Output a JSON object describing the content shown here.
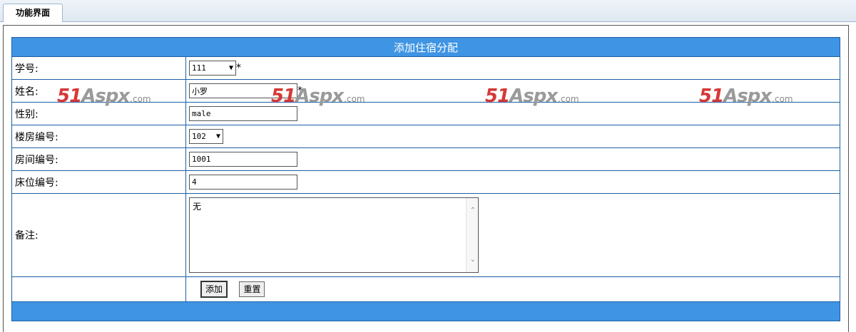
{
  "tab": {
    "label": "功能界面"
  },
  "form": {
    "title": "添加住宿分配",
    "required_mark": "*",
    "fields": {
      "student_id": {
        "label": "学号:",
        "value": "111"
      },
      "name": {
        "label": "姓名:",
        "value": "小罗"
      },
      "gender": {
        "label": "性别:",
        "value": "male"
      },
      "building": {
        "label": "楼房编号:",
        "value": "102"
      },
      "room": {
        "label": "房间编号:",
        "value": "1001"
      },
      "bed": {
        "label": "床位编号:",
        "value": "4"
      },
      "note": {
        "label": "备注:",
        "value": "无"
      }
    },
    "buttons": {
      "add": "添加",
      "reset": "重置"
    }
  },
  "watermark": {
    "number": "51",
    "brand": "Aspx",
    "suffix": ".com"
  }
}
